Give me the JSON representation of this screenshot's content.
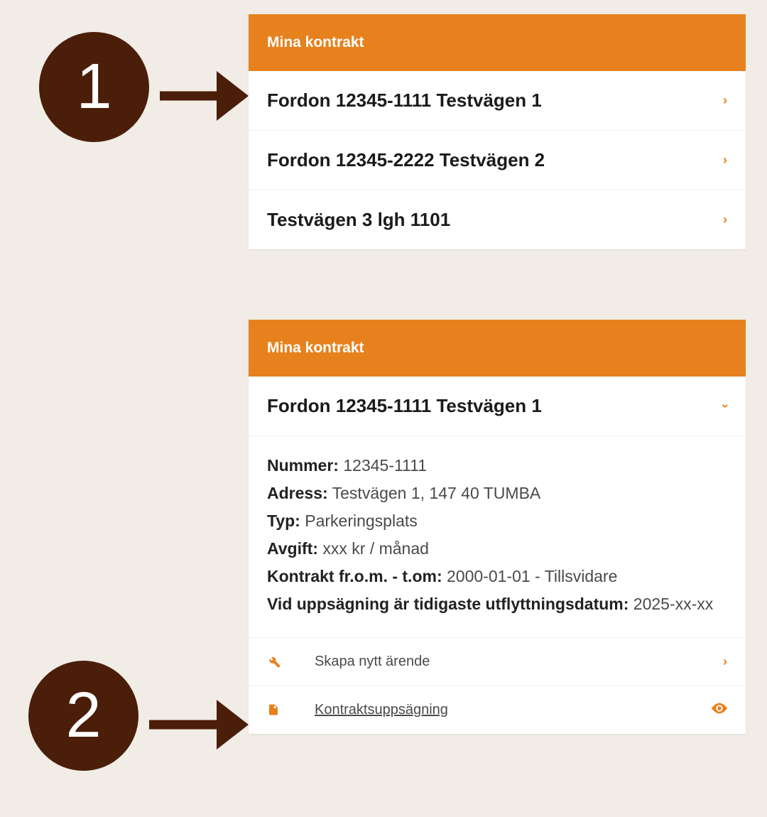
{
  "panel1": {
    "header": "Mina kontrakt",
    "items": [
      {
        "label": "Fordon 12345-1111 Testvägen 1"
      },
      {
        "label": "Fordon 12345-2222 Testvägen 2"
      },
      {
        "label": "Testvägen 3 lgh 1101"
      }
    ]
  },
  "panel2": {
    "header": "Mina kontrakt",
    "expanded": {
      "title": "Fordon 12345-1111 Testvägen 1",
      "fields": {
        "nummer_k": "Nummer:",
        "nummer_v": " 12345-1111",
        "adress_k": "Adress:",
        "adress_v": " Testvägen 1, 147 40 TUMBA",
        "typ_k": "Typ:",
        "typ_v": " Parkeringsplats",
        "avgift_k": "Avgift:",
        "avgift_v": " xxx kr / månad",
        "kontrakt_k": "Kontrakt fr.o.m. - t.om:",
        "kontrakt_v": " 2000-01-01 - Tillsvidare",
        "uppsagning_k": "Vid uppsägning är tidigaste utflyttningsdatum:",
        "uppsagning_v": " 2025-xx-xx"
      }
    },
    "actions": {
      "skapa": "Skapa nytt ärende",
      "kontrakt": "Kontraktsuppsägning"
    }
  },
  "steps": {
    "one": "1",
    "two": "2"
  }
}
